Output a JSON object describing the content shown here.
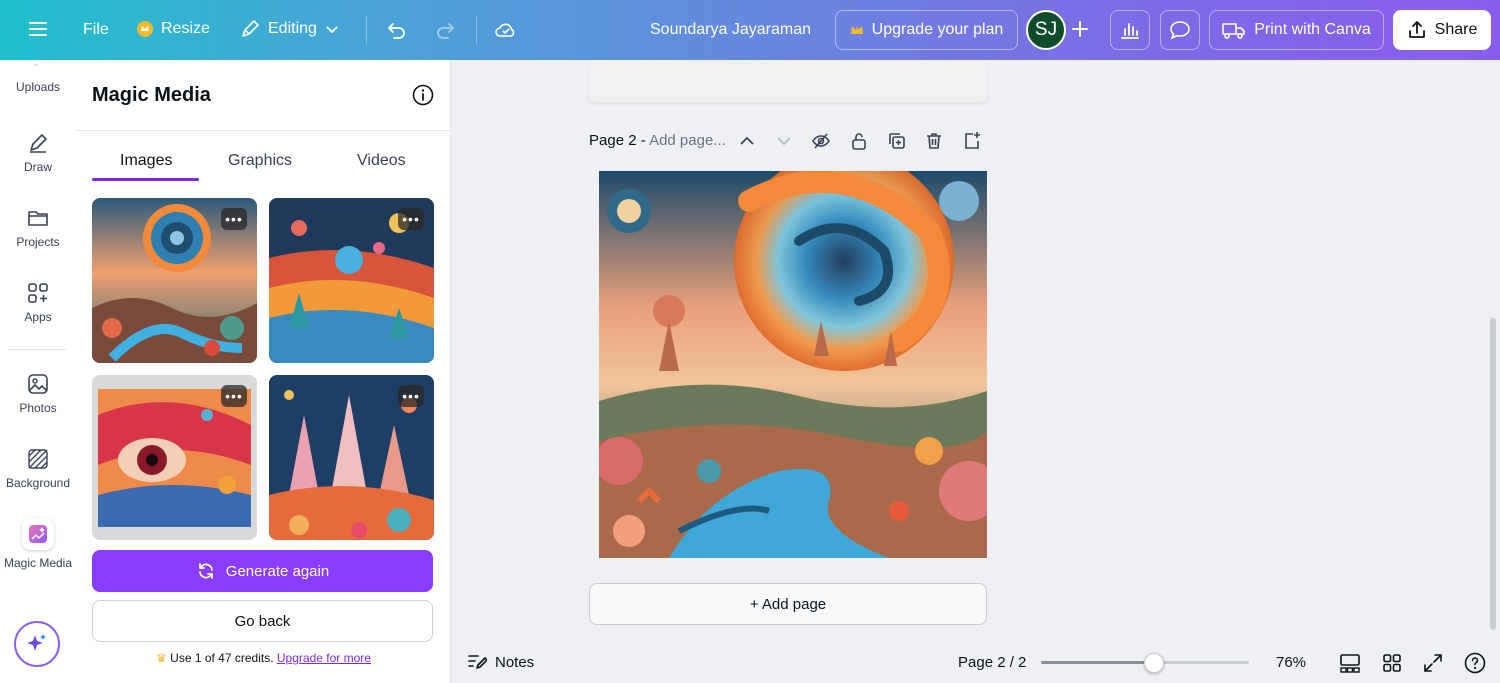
{
  "topbar": {
    "menu_icon": "hamburger-icon",
    "file_label": "File",
    "resize_label": "Resize",
    "editing_label": "Editing",
    "user_name": "Soundarya Jayaraman",
    "upgrade_label": "Upgrade your plan",
    "avatar_initials": "SJ",
    "print_label": "Print with Canva",
    "share_label": "Share"
  },
  "rail": {
    "items": [
      {
        "label": "Uploads",
        "icon": "upload-icon"
      },
      {
        "label": "Draw",
        "icon": "pen-icon"
      },
      {
        "label": "Projects",
        "icon": "folder-icon"
      },
      {
        "label": "Apps",
        "icon": "apps-icon"
      },
      {
        "label": "Photos",
        "icon": "photo-icon"
      },
      {
        "label": "Background",
        "icon": "background-icon"
      },
      {
        "label": "Magic Media",
        "icon": "magic-media-icon"
      }
    ]
  },
  "panel": {
    "title": "Magic Media",
    "tabs": [
      "Images",
      "Graphics",
      "Videos"
    ],
    "active_tab": "Images",
    "generate_label": "Generate again",
    "back_label": "Go back",
    "credits_text": "Use 1 of 47 credits.",
    "credits_link": "Upgrade for more"
  },
  "canvas": {
    "page_label": "Page 2 -",
    "page_title_placeholder": "Add page...",
    "add_page_label": "+ Add page"
  },
  "bottombar": {
    "notes_label": "Notes",
    "page_count": "Page 2 / 2",
    "zoom_label": "76%",
    "zoom_value": 76
  },
  "colors": {
    "accent": "#8b3dff",
    "link": "#7d2ae8"
  }
}
